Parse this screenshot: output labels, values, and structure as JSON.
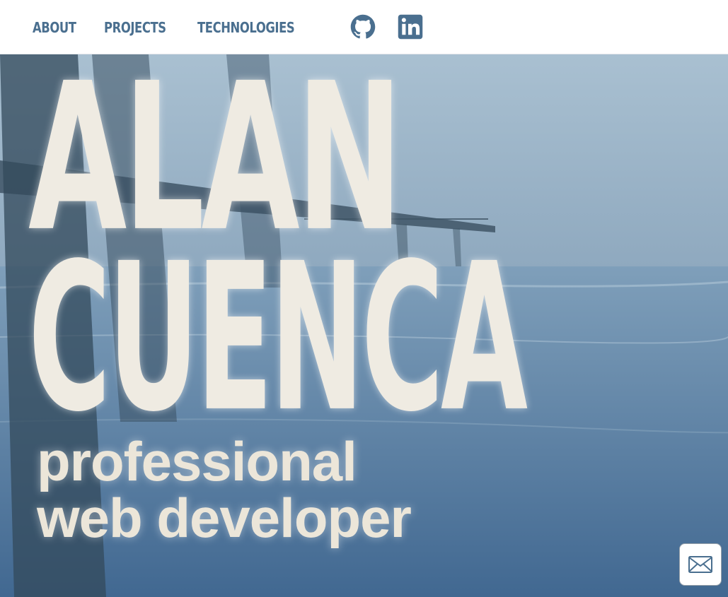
{
  "nav": {
    "links": [
      {
        "label": "ABOUT"
      },
      {
        "label": "PROJECTS"
      },
      {
        "label": "TECHNOLOGIES"
      }
    ],
    "social": [
      {
        "icon": "github-icon"
      },
      {
        "icon": "linkedin-icon"
      }
    ]
  },
  "hero": {
    "name_line1": "ALAN",
    "name_line2": "CUENCA",
    "tagline_line1": "professional",
    "tagline_line2": "web developer",
    "background": "pier-at-beach-photo"
  },
  "contact": {
    "icon": "envelope-icon"
  },
  "colors": {
    "nav_text": "#4a6f8f",
    "hero_text": "#efebe2",
    "icon": "#4a6f8f"
  }
}
